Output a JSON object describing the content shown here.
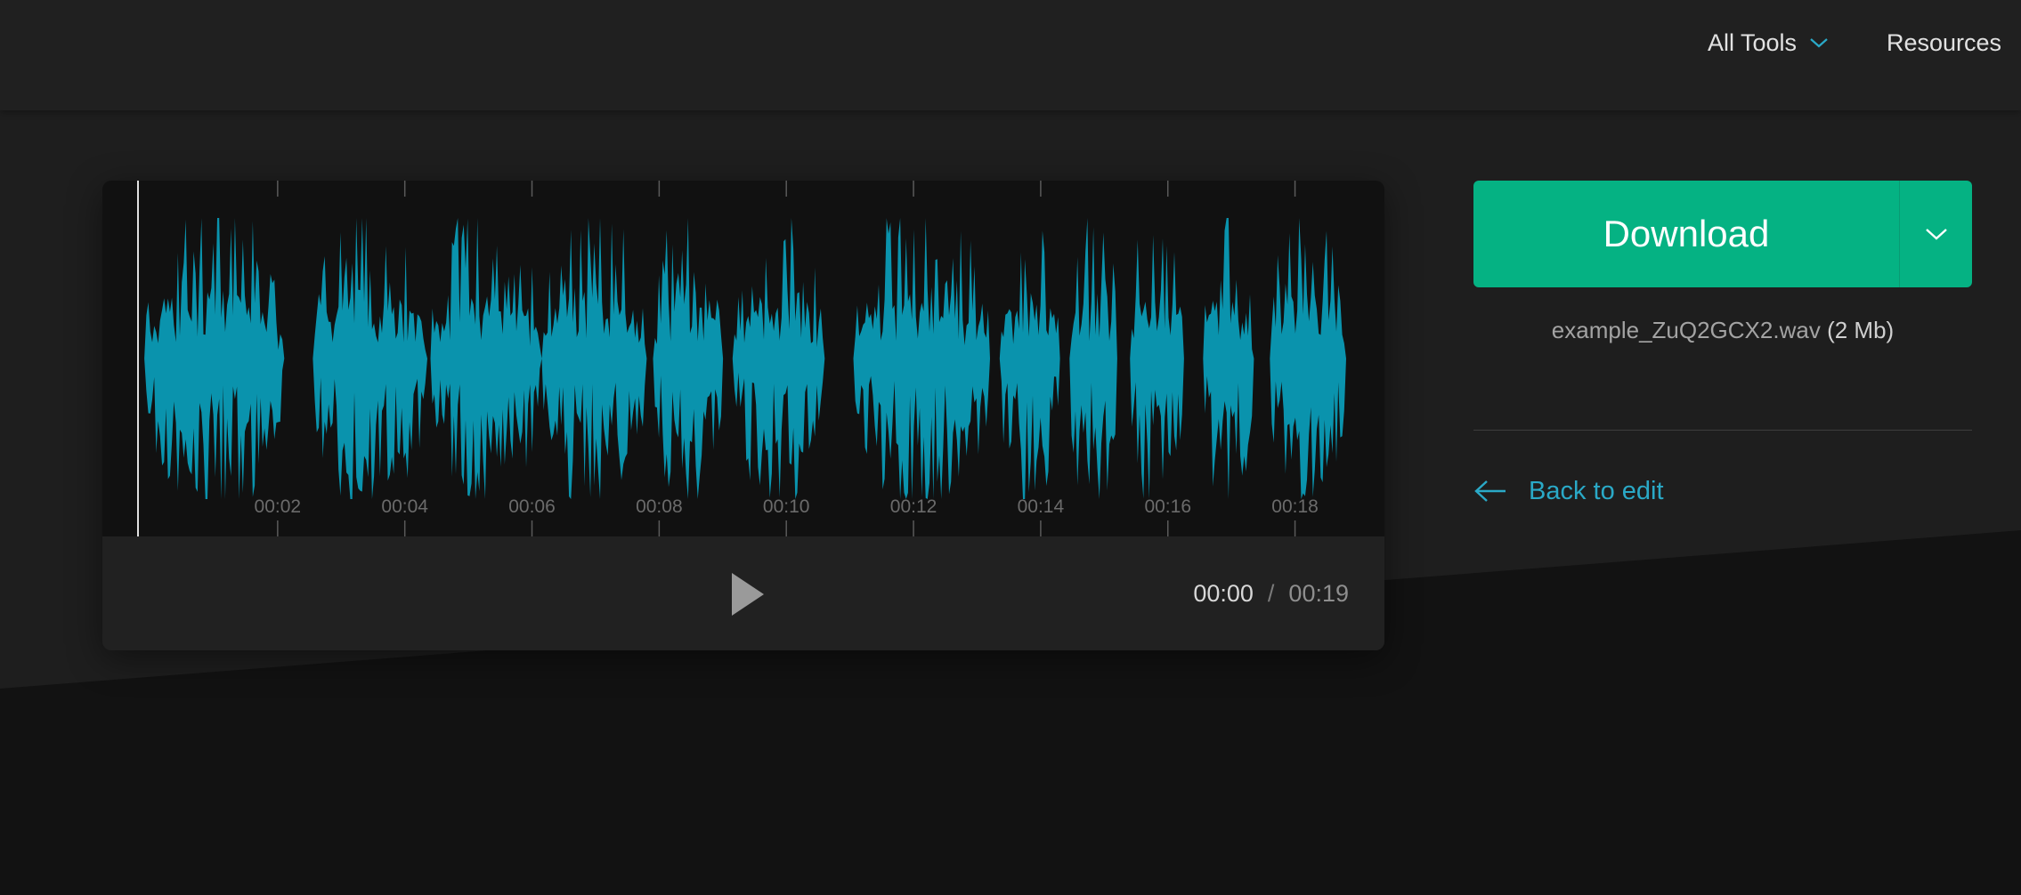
{
  "nav": {
    "all_tools_label": "All Tools",
    "resources_label": "Resources"
  },
  "player": {
    "tick_labels": [
      "00:02",
      "00:04",
      "00:06",
      "00:08",
      "00:10",
      "00:12",
      "00:14",
      "00:16",
      "00:18"
    ],
    "current_time": "00:00",
    "time_separator": "/",
    "total_time": "00:19",
    "duration_seconds": 19,
    "playhead_seconds": 0,
    "wave_color": "#0a93ad"
  },
  "download": {
    "label": "Download",
    "accent_color": "#05b283"
  },
  "file": {
    "name": "example_ZuQ2GCX2.wav",
    "size": "(2 Mb)"
  },
  "back_link": {
    "label": "Back to edit"
  }
}
